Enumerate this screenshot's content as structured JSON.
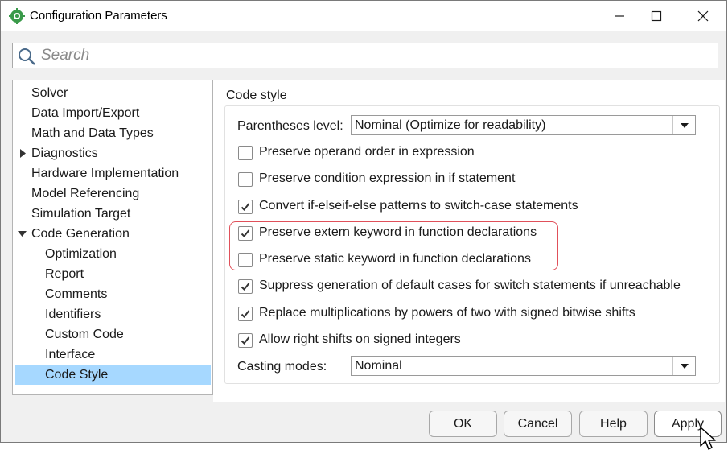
{
  "window": {
    "title": "Configuration Parameters",
    "controls": [
      "minimize-icon",
      "maximize-icon",
      "close-icon"
    ]
  },
  "search": {
    "placeholder": "Search",
    "value": ""
  },
  "tree": {
    "items": [
      {
        "label": "Solver",
        "level": 0,
        "expander": "none",
        "selected": false
      },
      {
        "label": "Data Import/Export",
        "level": 0,
        "expander": "none",
        "selected": false
      },
      {
        "label": "Math and Data Types",
        "level": 0,
        "expander": "none",
        "selected": false
      },
      {
        "label": "Diagnostics",
        "level": 0,
        "expander": "collapsed",
        "selected": false
      },
      {
        "label": "Hardware Implementation",
        "level": 0,
        "expander": "none",
        "selected": false
      },
      {
        "label": "Model Referencing",
        "level": 0,
        "expander": "none",
        "selected": false
      },
      {
        "label": "Simulation Target",
        "level": 0,
        "expander": "none",
        "selected": false
      },
      {
        "label": "Code Generation",
        "level": 0,
        "expander": "expanded",
        "selected": false
      },
      {
        "label": "Optimization",
        "level": 1,
        "expander": "none",
        "selected": false
      },
      {
        "label": "Report",
        "level": 1,
        "expander": "none",
        "selected": false
      },
      {
        "label": "Comments",
        "level": 1,
        "expander": "none",
        "selected": false
      },
      {
        "label": "Identifiers",
        "level": 1,
        "expander": "none",
        "selected": false
      },
      {
        "label": "Custom Code",
        "level": 1,
        "expander": "none",
        "selected": false
      },
      {
        "label": "Interface",
        "level": 1,
        "expander": "none",
        "selected": false
      },
      {
        "label": "Code Style",
        "level": 1,
        "expander": "none",
        "selected": true
      }
    ]
  },
  "panel": {
    "section_title": "Code style",
    "parentheses": {
      "label": "Parentheses level:",
      "value": "Nominal (Optimize for readability)"
    },
    "checkboxes": [
      {
        "label": "Preserve operand order in expression",
        "checked": false
      },
      {
        "label": "Preserve condition expression in if statement",
        "checked": false
      },
      {
        "label": "Convert if-elseif-else patterns to switch-case statements",
        "checked": true
      },
      {
        "label": "Preserve extern keyword in function declarations",
        "checked": true
      },
      {
        "label": "Preserve static keyword in function declarations",
        "checked": false
      },
      {
        "label": "Suppress generation of default cases for switch statements if unreachable",
        "checked": true
      },
      {
        "label": "Replace multiplications by powers of two with signed bitwise shifts",
        "checked": true
      },
      {
        "label": "Allow right shifts on signed integers",
        "checked": true
      }
    ],
    "casting": {
      "label": "Casting modes:",
      "value": "Nominal"
    }
  },
  "buttons": {
    "ok": "OK",
    "cancel": "Cancel",
    "help": "Help",
    "apply": "Apply"
  },
  "colors": {
    "selection": "#a6d8ff",
    "highlight_outline": "#e0505a",
    "app_icon": "#3a9a4a"
  }
}
